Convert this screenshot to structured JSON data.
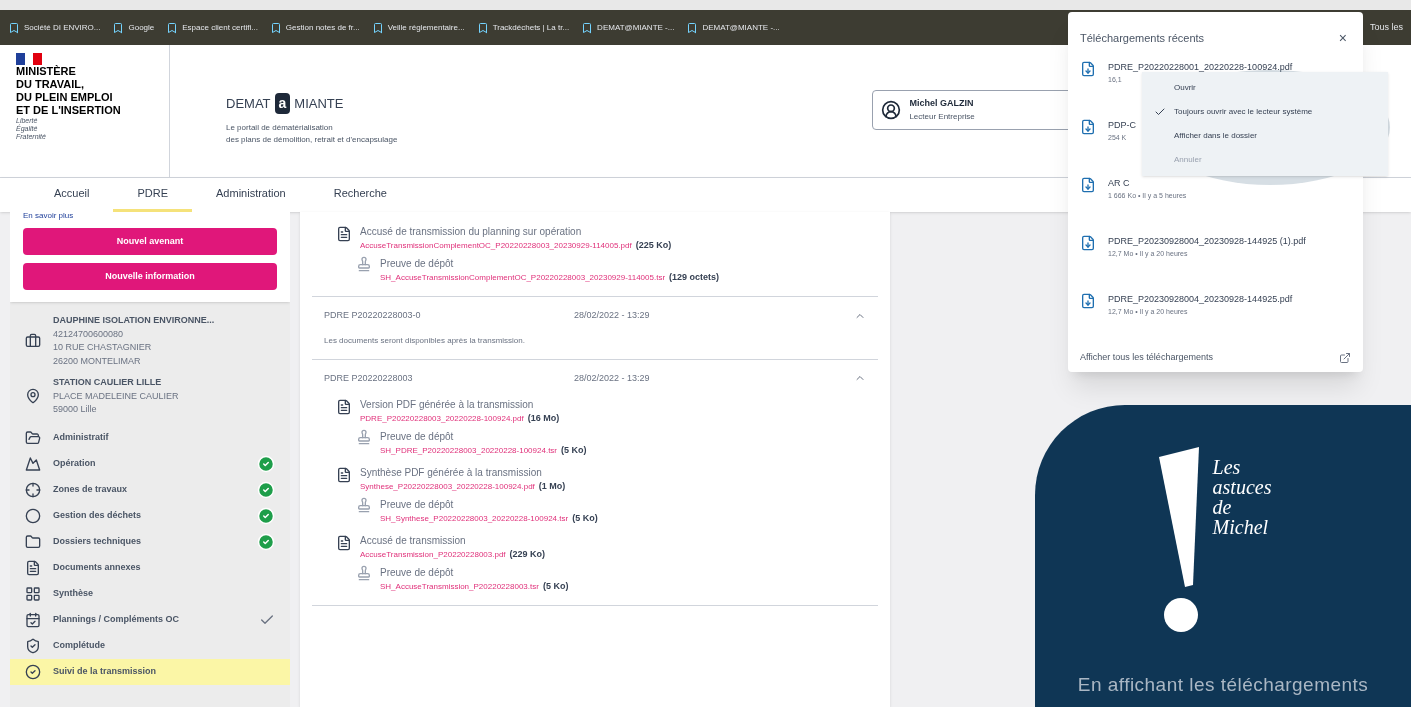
{
  "bookmarks": [
    {
      "label": "Société DI ENVIRO..."
    },
    {
      "label": "Google"
    },
    {
      "label": "Espace client certifi..."
    },
    {
      "label": "Gestion notes de fr..."
    },
    {
      "label": "Veille réglementaire..."
    },
    {
      "label": "Trackdéchets | La tr..."
    },
    {
      "label": "DEMAT@MIANTE -..."
    },
    {
      "label": "DEMAT@MIANTE -..."
    }
  ],
  "bookmarks_more": "Tous les",
  "ministry": {
    "lines": [
      "MINISTÈRE",
      "DU TRAVAIL,",
      "DU PLEIN EMPLOI",
      "ET DE L'INSERTION"
    ],
    "motto": [
      "Liberté",
      "Égalité",
      "Fraternité"
    ]
  },
  "app": {
    "title_before": "DEMAT",
    "title_letter": "a",
    "title_after": "MIANTE",
    "subtitle": [
      "Le portail de dématérialisation",
      "des plans de démolition, retrait et d'encapsulage"
    ]
  },
  "user": {
    "name": "Michel GALZIN",
    "role": "Lecteur Entreprise"
  },
  "tabs": [
    {
      "label": "Accueil",
      "selected": false
    },
    {
      "label": "PDRE",
      "selected": true
    },
    {
      "label": "Administration",
      "selected": false
    },
    {
      "label": "Recherche",
      "selected": false
    }
  ],
  "sidebar": {
    "link": "En savoir plus",
    "buttons": [
      "Nouvel avenant",
      "Nouvelle information"
    ],
    "company": {
      "name": "DAUPHINE ISOLATION ENVIRONNE...",
      "lines": [
        "42124700600080",
        "10 RUE CHASTAGNIER",
        "26200 MONTELIMAR"
      ]
    },
    "site": {
      "name": "STATION CAULIER LILLE",
      "lines": [
        "PLACE MADELEINE CAULIER",
        "59000 Lille"
      ]
    },
    "items": [
      {
        "label": "Administratif",
        "validated": false,
        "ticked": false,
        "selected": false
      },
      {
        "label": "Opération",
        "validated": true,
        "ticked": false,
        "selected": false
      },
      {
        "label": "Zones de travaux",
        "validated": true,
        "ticked": false,
        "selected": false
      },
      {
        "label": "Gestion des déchets",
        "validated": true,
        "ticked": false,
        "selected": false
      },
      {
        "label": "Dossiers techniques",
        "validated": true,
        "ticked": false,
        "selected": false
      },
      {
        "label": "Documents annexes",
        "validated": false,
        "ticked": false,
        "selected": false
      },
      {
        "label": "Synthèse",
        "validated": false,
        "ticked": false,
        "selected": false
      },
      {
        "label": "Plannings / Compléments OC",
        "validated": false,
        "ticked": true,
        "selected": false
      },
      {
        "label": "Complétude",
        "validated": false,
        "ticked": false,
        "selected": false
      },
      {
        "label": "Suivi de la transmission",
        "validated": false,
        "ticked": false,
        "selected": true
      }
    ]
  },
  "sections": [
    {
      "documents": [
        {
          "title": "Accusé de transmission du planning sur opération",
          "file": "AccuseTransmissionComplementOC_P20220228003_20230929-114005.pdf",
          "size": "(225 Ko)",
          "proof_title": "Preuve de dépôt",
          "proof_file": "SH_AccuseTransmissionComplementOC_P20220228003_20230929-114005.tsr",
          "proof_size": "(129 octets)"
        }
      ]
    },
    {
      "header": {
        "name": "PDRE P20220228003-0",
        "date": "28/02/2022 - 13:29"
      },
      "expanded": true,
      "note": "Les documents seront disponibles après la transmission."
    },
    {
      "header": {
        "name": "PDRE P20220228003",
        "date": "28/02/2022 - 13:29"
      },
      "expanded": true,
      "documents": [
        {
          "title": "Version PDF générée à la transmission",
          "file": "PDRE_P20220228003_20220228-100924.pdf",
          "size": "(16 Mo)",
          "proof_title": "Preuve de dépôt",
          "proof_file": "SH_PDRE_P20220228003_20220228-100924.tsr",
          "proof_size": "(5 Ko)"
        },
        {
          "title": "Synthèse PDF générée à la transmission",
          "file": "Synthese_P20220228003_20220228-100924.pdf",
          "size": "(1 Mo)",
          "proof_title": "Preuve de dépôt",
          "proof_file": "SH_Synthese_P20220228003_20220228-100924.tsr",
          "proof_size": "(5 Ko)"
        },
        {
          "title": "Accusé de transmission",
          "file": "AccuseTransmission_P20220228003.pdf",
          "size": "(229 Ko)",
          "proof_title": "Preuve de dépôt",
          "proof_file": "SH_AccuseTransmission_P20220228003.tsr",
          "proof_size": "(5 Ko)"
        }
      ]
    }
  ],
  "downloads": {
    "title": "Téléchargements récents",
    "close": "×",
    "items": [
      {
        "name": "PDRE_P20220228001_20220228-100924.pdf",
        "meta": "16,1"
      },
      {
        "name": "PDP-C",
        "meta": "254 K"
      },
      {
        "name": "AR C",
        "meta": "1 666 Ko • Il y a 5 heures"
      },
      {
        "name": "PDRE_P20230928004_20230928-144925 (1).pdf",
        "meta": "12,7 Mo • Il y a 20 heures"
      },
      {
        "name": "PDRE_P20230928004_20230928-144925.pdf",
        "meta": "12,7 Mo • Il y a 20 heures"
      }
    ],
    "footer": "Afficher tous les téléchargements",
    "menu": [
      {
        "label": "Ouvrir",
        "checked": false,
        "disabled": false
      },
      {
        "label": "Toujours ouvrir avec le lecteur système",
        "checked": true,
        "disabled": false
      },
      {
        "label": "Afficher dans le dossier",
        "checked": false,
        "disabled": false
      },
      {
        "label": "Annuler",
        "checked": false,
        "disabled": true
      }
    ]
  },
  "tip": {
    "title": [
      "Les",
      "astuces",
      "de",
      "Michel"
    ],
    "text": "En affichant les téléchargements"
  }
}
